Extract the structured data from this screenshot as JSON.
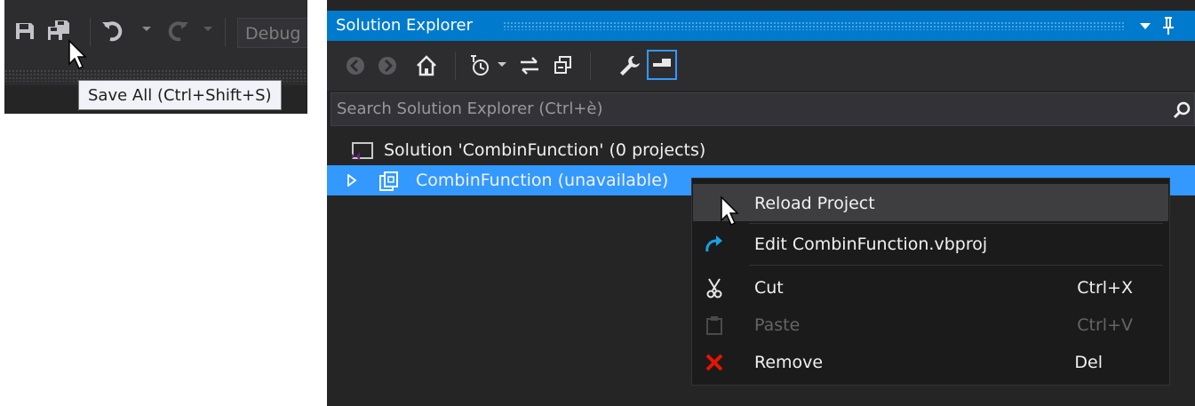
{
  "toolbar": {
    "save_label": "Save",
    "save_all_label": "Save All",
    "undo_label": "Undo",
    "redo_label": "Redo",
    "configuration": "Debug",
    "tooltip": "Save All (Ctrl+Shift+S)"
  },
  "solution_explorer": {
    "title": "Solution Explorer",
    "search_placeholder": "Search Solution Explorer (Ctrl+è)",
    "toolbar_icons": [
      "back-icon",
      "forward-icon",
      "home-icon",
      "pending-changes-filter-icon",
      "sync-icon",
      "collapse-all-icon",
      "properties-icon",
      "preview-icon"
    ],
    "tree": {
      "solution": "Solution 'CombinFunction' (0 projects)",
      "project": "CombinFunction (unavailable)"
    }
  },
  "context_menu": {
    "items": [
      {
        "label": "Reload Project",
        "shortcut": "",
        "icon": "",
        "enabled": true
      },
      {
        "label": "Edit CombinFunction.vbproj",
        "shortcut": "",
        "icon": "edit-redo-arrow-icon",
        "enabled": true
      },
      {
        "label": "Cut",
        "shortcut": "Ctrl+X",
        "icon": "scissors-icon",
        "enabled": true
      },
      {
        "label": "Paste",
        "shortcut": "Ctrl+V",
        "icon": "clipboard-icon",
        "enabled": false
      },
      {
        "label": "Remove",
        "shortcut": "Del",
        "icon": "red-x-icon",
        "enabled": true
      }
    ]
  },
  "colors": {
    "accent": "#007acc",
    "selection": "#3399ff",
    "panel_bg": "#252526",
    "toolbar_bg": "#2d2d30",
    "menu_bg": "#1b1b1c",
    "remove_icon": "#e51400",
    "edit_icon": "#1ba1e2"
  }
}
